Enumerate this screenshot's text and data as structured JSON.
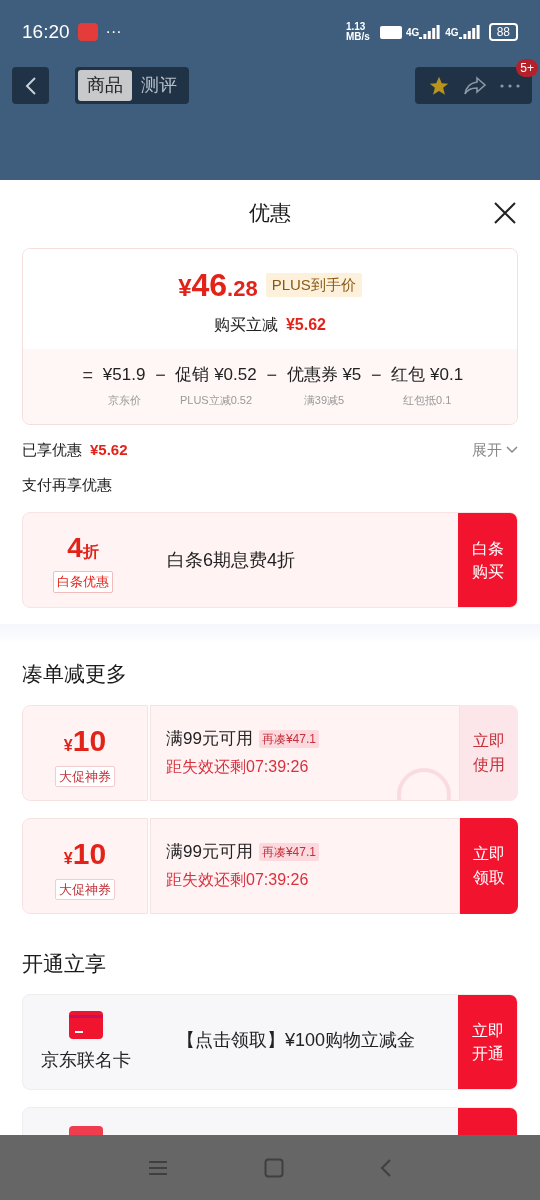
{
  "status_bar": {
    "time": "16:20",
    "more": "···",
    "speed": "1.13 MB/s",
    "network": [
      "4G",
      "4G"
    ],
    "battery": "88"
  },
  "nav": {
    "tabs": [
      {
        "label": "商品",
        "selected": true
      },
      {
        "label": "测评",
        "selected": false
      }
    ],
    "badge": "5+"
  },
  "sheet": {
    "title": "优惠",
    "price": {
      "symbol": "¥",
      "integer": "46",
      "decimal": ".28",
      "tag": "PLUS到手价",
      "reduction_label": "购买立减",
      "reduction": "¥5.62"
    },
    "breakdown": [
      {
        "operator": "=",
        "amount": "¥51.9",
        "note": "京东价"
      },
      {
        "operator": "−",
        "amount": "促销 ¥0.52",
        "note": "PLUS立减0.52"
      },
      {
        "operator": "−",
        "amount": "优惠券 ¥5",
        "note": "满39减5"
      },
      {
        "operator": "−",
        "amount": "红包 ¥0.1",
        "note": "红包抵0.1"
      }
    ],
    "enjoyed": {
      "label": "已享优惠",
      "amount": "¥5.62",
      "toggle": "展开",
      "expanded": false
    },
    "pay_title": "支付再享优惠",
    "baitiao": {
      "value": "4",
      "unit": "折",
      "tag": "白条优惠",
      "text": "白条6期息费4折",
      "button": "白条购买"
    },
    "coupon_title": "凑单减更多",
    "coupons": [
      {
        "symbol": "¥",
        "amount": "10",
        "tag": "大促神券",
        "condition": "满99元可用",
        "extra": "再凑¥47.1",
        "countdown": "距失效还剩07:39:26",
        "button": "立即使用",
        "claimed": true
      },
      {
        "symbol": "¥",
        "amount": "10",
        "tag": "大促神券",
        "condition": "满99元可用",
        "extra": "再凑¥47.1",
        "countdown": "距失效还剩07:39:26",
        "button": "立即领取",
        "claimed": false
      }
    ],
    "open_title": "开通立享",
    "offers": [
      {
        "kind": "card",
        "name": "京东联名卡",
        "text": "【点击领取】¥100购物立减金",
        "button": "立即开通"
      },
      {
        "kind": "cut_off"
      }
    ]
  }
}
